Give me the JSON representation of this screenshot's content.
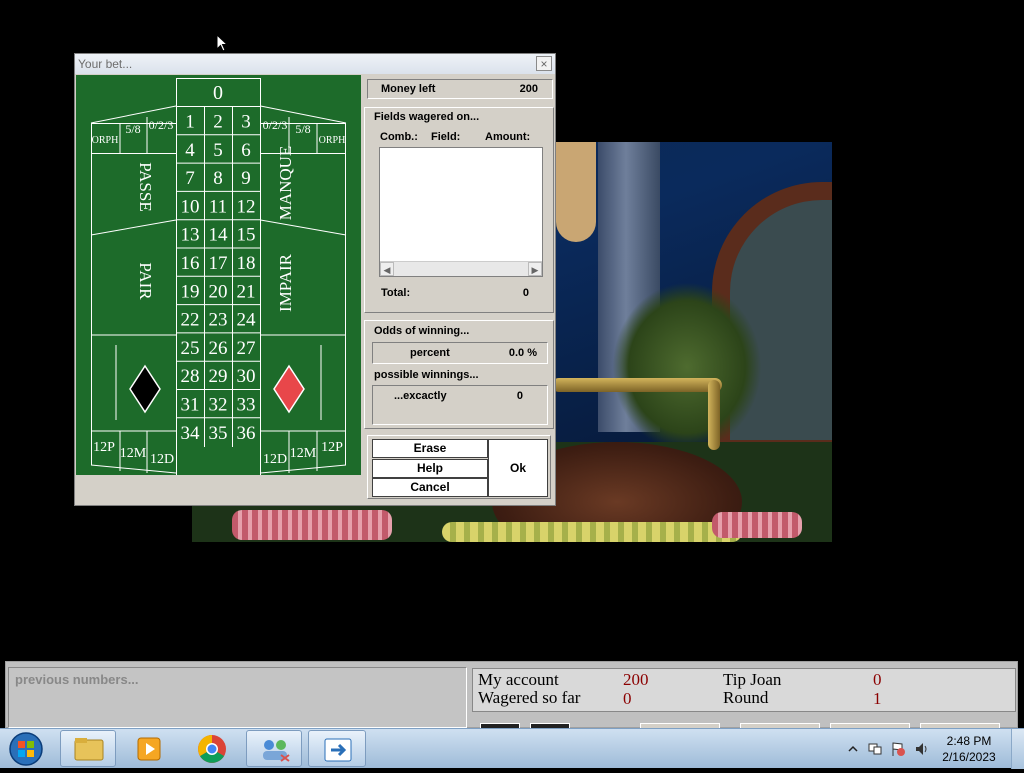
{
  "dialog": {
    "title": "Your bet...",
    "close": "×",
    "money_left_label": "Money left",
    "money_left_value": "200",
    "fields_heading": "Fields wagered on...",
    "columns": [
      "Comb.:",
      "Field:",
      "Amount:"
    ],
    "total_label": "Total:",
    "total_value": "0",
    "odds_heading": "Odds of winning...",
    "percent_label": "percent",
    "percent_value": "0.0 %",
    "winnings_heading": "possible winnings...",
    "exactly_label": "...excactly",
    "exactly_value": "0",
    "buttons": {
      "erase": "Erase",
      "help": "Help",
      "cancel": "Cancel",
      "ok": "Ok"
    }
  },
  "board": {
    "zero": "0",
    "numbers": [
      "1",
      "2",
      "3",
      "4",
      "5",
      "6",
      "7",
      "8",
      "9",
      "10",
      "11",
      "12",
      "13",
      "14",
      "15",
      "16",
      "17",
      "18",
      "19",
      "20",
      "21",
      "22",
      "23",
      "24",
      "25",
      "26",
      "27",
      "28",
      "29",
      "30",
      "31",
      "32",
      "33",
      "34",
      "35",
      "36"
    ],
    "left_top": [
      "ORPH",
      "5/8",
      "0/2/3"
    ],
    "right_top": [
      "0/2/3",
      "5/8",
      "ORPH"
    ],
    "passe": "PASSE",
    "manque": "MANQUE",
    "pair": "PAIR",
    "impair": "IMPAIR",
    "dozens_left": [
      "12P",
      "12M",
      "12D"
    ],
    "dozens_right": [
      "12D",
      "12M",
      "12P"
    ]
  },
  "status": {
    "previous_numbers": "previous numbers...",
    "my_account_label": "My account",
    "my_account_value": "200",
    "wagered_label": "Wagered so far",
    "wagered_value": "0",
    "tip_label": "Tip Joan",
    "tip_value": "0",
    "round_label": "Round",
    "round_value": "1"
  },
  "taskbar": {
    "time": "2:48 PM",
    "date": "2/16/2023"
  },
  "colors": {
    "felt": "#1d6b2a",
    "red_diamond": "#e8474a",
    "accent_red": "#8b0000"
  }
}
